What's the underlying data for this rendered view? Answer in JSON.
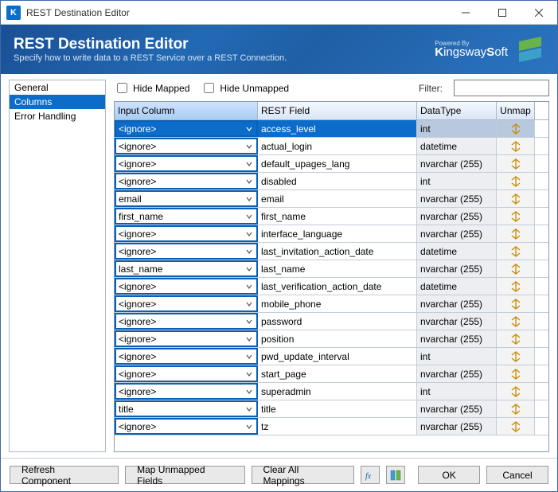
{
  "window": {
    "title": "REST Destination Editor"
  },
  "header": {
    "title": "REST Destination Editor",
    "subtitle": "Specify how to write data to a REST Service over a REST Connection.",
    "powered_by": "Powered By",
    "brand": "KingswaySoft"
  },
  "sidebar": {
    "items": [
      {
        "label": "General",
        "selected": false
      },
      {
        "label": "Columns",
        "selected": true
      },
      {
        "label": "Error Handling",
        "selected": false
      }
    ]
  },
  "toolbar": {
    "hide_mapped": "Hide Mapped",
    "hide_unmapped": "Hide Unmapped",
    "filter_label": "Filter:",
    "filter_value": ""
  },
  "grid": {
    "headers": {
      "input": "Input Column",
      "field": "REST Field",
      "type": "DataType",
      "unmap": "Unmap"
    },
    "rows": [
      {
        "input": "<ignore>",
        "field": "access_level",
        "type": "int",
        "selected": true
      },
      {
        "input": "<ignore>",
        "field": "actual_login",
        "type": "datetime",
        "selected": false
      },
      {
        "input": "<ignore>",
        "field": "default_upages_lang",
        "type": "nvarchar (255)",
        "selected": false
      },
      {
        "input": "<ignore>",
        "field": "disabled",
        "type": "int",
        "selected": false
      },
      {
        "input": "email",
        "field": "email",
        "type": "nvarchar (255)",
        "selected": false
      },
      {
        "input": "first_name",
        "field": "first_name",
        "type": "nvarchar (255)",
        "selected": false
      },
      {
        "input": "<ignore>",
        "field": "interface_language",
        "type": "nvarchar (255)",
        "selected": false
      },
      {
        "input": "<ignore>",
        "field": "last_invitation_action_date",
        "type": "datetime",
        "selected": false
      },
      {
        "input": "last_name",
        "field": "last_name",
        "type": "nvarchar (255)",
        "selected": false
      },
      {
        "input": "<ignore>",
        "field": "last_verification_action_date",
        "type": "datetime",
        "selected": false
      },
      {
        "input": "<ignore>",
        "field": "mobile_phone",
        "type": "nvarchar (255)",
        "selected": false
      },
      {
        "input": "<ignore>",
        "field": "password",
        "type": "nvarchar (255)",
        "selected": false
      },
      {
        "input": "<ignore>",
        "field": "position",
        "type": "nvarchar (255)",
        "selected": false
      },
      {
        "input": "<ignore>",
        "field": "pwd_update_interval",
        "type": "int",
        "selected": false
      },
      {
        "input": "<ignore>",
        "field": "start_page",
        "type": "nvarchar (255)",
        "selected": false
      },
      {
        "input": "<ignore>",
        "field": "superadmin",
        "type": "int",
        "selected": false
      },
      {
        "input": "title",
        "field": "title",
        "type": "nvarchar (255)",
        "selected": false
      },
      {
        "input": "<ignore>",
        "field": "tz",
        "type": "nvarchar (255)",
        "selected": false
      }
    ]
  },
  "footer": {
    "refresh": "Refresh Component",
    "map_unmapped": "Map Unmapped Fields",
    "clear": "Clear All Mappings",
    "ok": "OK",
    "cancel": "Cancel"
  }
}
